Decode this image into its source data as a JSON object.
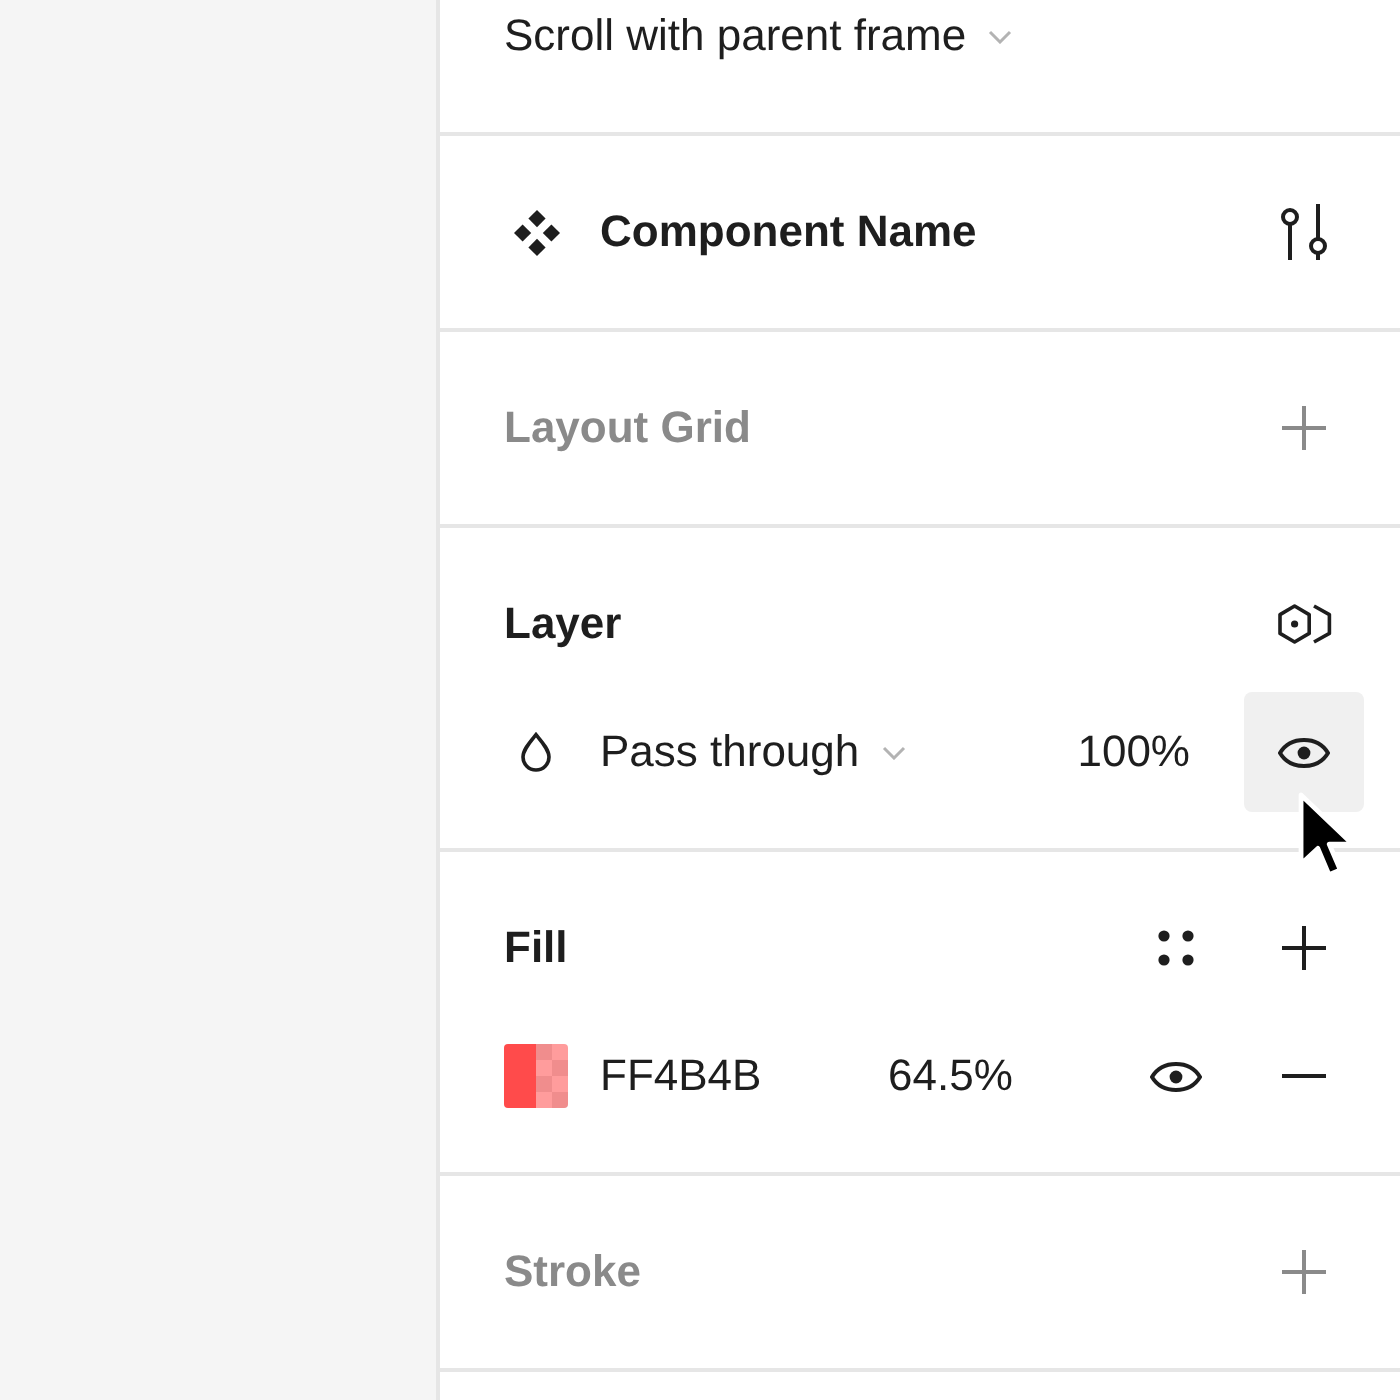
{
  "scroll_behavior": {
    "value": "Scroll with parent frame"
  },
  "component": {
    "name": "Component Name"
  },
  "layout_grid": {
    "title": "Layout Grid",
    "empty": true
  },
  "layer": {
    "title": "Layer",
    "blend_mode": "Pass through",
    "opacity": "100%",
    "visible": true,
    "visibility_hovered": true
  },
  "fill": {
    "title": "Fill",
    "empty": false,
    "items": [
      {
        "hex": "FF4B4B",
        "color": "#ff4b4b",
        "opacity": "64.5%",
        "visible": true
      }
    ]
  },
  "stroke": {
    "title": "Stroke",
    "empty": true
  }
}
